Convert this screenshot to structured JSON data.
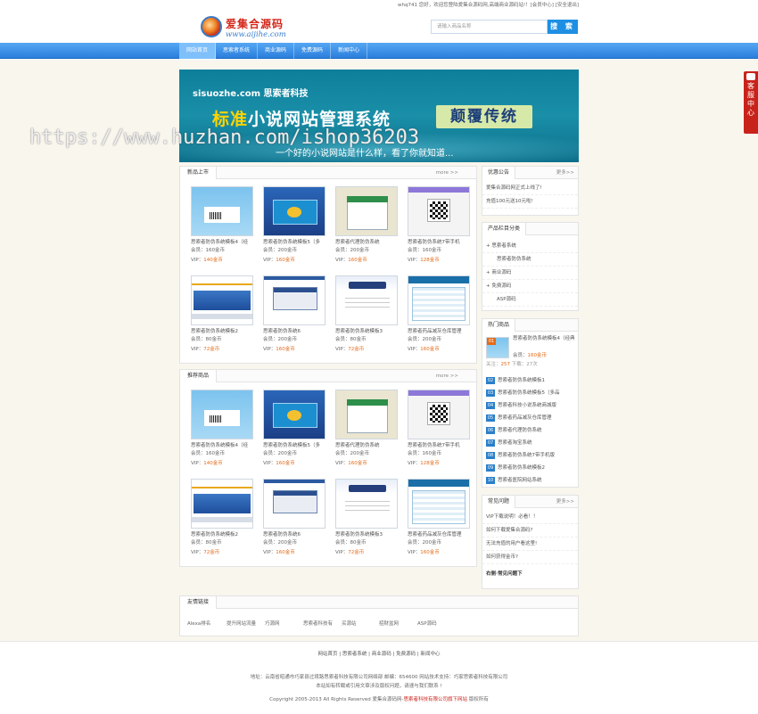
{
  "topbar": {
    "welcome": "whq741 您好，欢迎您登陆爱集合源码网,高端商业源码站!！[会员中心] [安全退出]"
  },
  "logo": {
    "cn": "爱集合源码",
    "en": "www.aijihe.com"
  },
  "search": {
    "placeholder": "请输入商品名称",
    "button": "搜 索"
  },
  "nav": [
    "网站首页",
    "思索者系统",
    "商业源码",
    "免费源码",
    "新闻中心"
  ],
  "banner": {
    "company": "sisuozhe.com 思索者科技",
    "title_a": "标准",
    "title_b": "小说网站管理系统",
    "tag": "颠覆传统",
    "sub": "一个好的小说网站是什么样，看了你就知道..."
  },
  "watermark": "https://www.huzhan.com/ishop36203",
  "labels": {
    "member": "会员：",
    "vip": "VIP："
  },
  "new_products": {
    "title": "新品上市",
    "more": "more >>",
    "items": [
      {
        "name": "思索者防伪系统模板4（经",
        "member": "160金币",
        "vip": "140金币",
        "thumb": "t1"
      },
      {
        "name": "思索者防伪系统模板5（多",
        "member": "200金币",
        "vip": "160金币",
        "thumb": "t2"
      },
      {
        "name": "思索者代理防伪系统",
        "member": "200金币",
        "vip": "160金币",
        "thumb": "t3"
      },
      {
        "name": "思索者防伪系统7带手机",
        "member": "160金币",
        "vip": "128金币",
        "thumb": "t4"
      },
      {
        "name": "思索者防伪系统模板2",
        "member": "80金币",
        "vip": "72金币",
        "thumb": "t5"
      },
      {
        "name": "思索者防伪系统6",
        "member": "200金币",
        "vip": "160金币",
        "thumb": "t6"
      },
      {
        "name": "思索者防伪系统模板3",
        "member": "80金币",
        "vip": "72金币",
        "thumb": "t7"
      },
      {
        "name": "思索者药品减灰仓库管理",
        "member": "200金币",
        "vip": "160金币",
        "thumb": "t8"
      }
    ]
  },
  "recommended": {
    "title": "推荐商品",
    "more": "more >>",
    "items": [
      {
        "name": "思索者防伪系统模板4（经",
        "member": "160金币",
        "vip": "140金币",
        "thumb": "t1"
      },
      {
        "name": "思索者防伪系统模板5（多",
        "member": "200金币",
        "vip": "160金币",
        "thumb": "t2"
      },
      {
        "name": "思索者代理防伪系统",
        "member": "200金币",
        "vip": "160金币",
        "thumb": "t3"
      },
      {
        "name": "思索者防伪系统7带手机",
        "member": "160金币",
        "vip": "128金币",
        "thumb": "t4"
      },
      {
        "name": "思索者防伪系统模板2",
        "member": "80金币",
        "vip": "72金币",
        "thumb": "t5"
      },
      {
        "name": "思索者防伪系统6",
        "member": "200金币",
        "vip": "160金币",
        "thumb": "t6"
      },
      {
        "name": "思索者防伪系统模板3",
        "member": "80金币",
        "vip": "72金币",
        "thumb": "t7"
      },
      {
        "name": "思索者药品减灰仓库管理",
        "member": "200金币",
        "vip": "160金币",
        "thumb": "t8"
      }
    ]
  },
  "notice": {
    "title": "优惠公告",
    "more": "更多>>",
    "items": [
      "爱集合源码网正式上线了!",
      "充值100元送10元啦!"
    ]
  },
  "categories": {
    "title": "产品栏目分类",
    "items": [
      {
        "label": "+ 思索者系统",
        "sub": false
      },
      {
        "label": "思索者防伪系统",
        "sub": true
      },
      {
        "label": "+ 商业源码",
        "sub": false
      },
      {
        "label": "+ 免费源码",
        "sub": false
      },
      {
        "label": "ASP源码",
        "sub": true
      }
    ]
  },
  "hot": {
    "title": "热门商品",
    "top": {
      "name": "思索者防伪系统模板4（经典",
      "member": "160金币",
      "stats_a": "关注：",
      "views": "257",
      "stats_b": "下载：",
      "downloads": "27",
      "stats_c": "次"
    },
    "items": [
      {
        "rank": "02",
        "name": "思索者防伪系统模板1"
      },
      {
        "rank": "03",
        "name": "思索者防伪系统模板5（多品"
      },
      {
        "rank": "04",
        "name": "思索者科技小说系统商城版"
      },
      {
        "rank": "05",
        "name": "思索者药品减灰仓库管理"
      },
      {
        "rank": "06",
        "name": "思索者代理防伪系统"
      },
      {
        "rank": "07",
        "name": "思索者淘宝系统"
      },
      {
        "rank": "08",
        "name": "思索者防伪系统7带手机版"
      },
      {
        "rank": "09",
        "name": "思索者防伪系统模板2"
      },
      {
        "rank": "10",
        "name": "思索者医院网站系统"
      }
    ]
  },
  "faq": {
    "title": "常见问题",
    "more": "更多>>",
    "items": [
      "VIP下载说明！必看！！",
      "如何下载爱集合源码?",
      "无法充值的用户看这里!",
      "如何获得金币?"
    ],
    "footer": "右侧·常见问题下"
  },
  "links": {
    "title": "友情链接",
    "items": [
      "Alexa排名",
      "提升网站流量",
      "巧源网",
      "思索者科技有",
      "买源站",
      "招财盆网",
      "ASP源码"
    ]
  },
  "cs": "客服中心",
  "footer": {
    "links": "网站首页 | 思索者系统 | 商业源码 | 免费源码 | 新闻中心",
    "address": "地址：云南省昭通市巧家县过境路思索者科技有限公司网络部     邮编：654600 网站技术支持：巧家思索者科技有限公司",
    "notice": "本站如有转载或引用文章涉及版权问题，请速与我们联系 !",
    "copy_a": "Copyright 2005-2013 All Rights Reserved 爱集合源码网-",
    "copy_b": "思索者科技有限公司旗下网站",
    "copy_c": "版权所有"
  }
}
